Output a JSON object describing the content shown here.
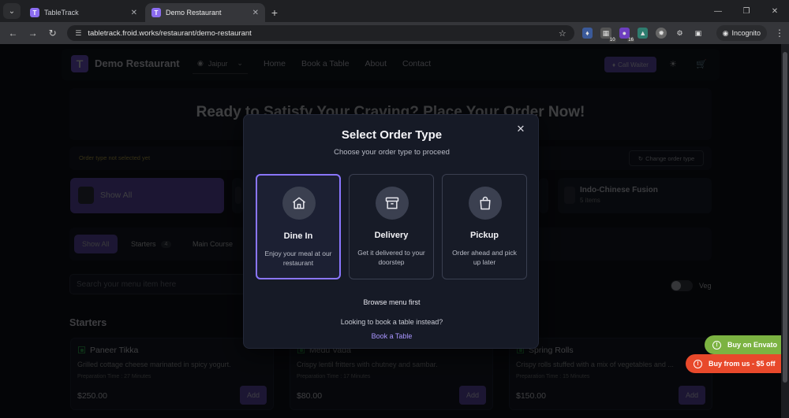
{
  "browser": {
    "tabs": [
      {
        "title": "TableTrack",
        "favicon": "T"
      },
      {
        "title": "Demo Restaurant",
        "favicon": "T"
      }
    ],
    "url": "tabletrack.froid.works/restaurant/demo-restaurant",
    "extensions": [
      {
        "icon": "shield-ext-icon",
        "badge": ""
      },
      {
        "icon": "grid-ext-icon",
        "badge": "10"
      },
      {
        "icon": "purple-ext-icon",
        "badge": "16"
      },
      {
        "icon": "color-ext-icon",
        "badge": ""
      },
      {
        "icon": "wheel-ext-icon",
        "badge": ""
      }
    ],
    "incognito_label": "Incognito"
  },
  "header": {
    "logo_letter": "T",
    "brand": "Demo Restaurant",
    "location": "Jaipur",
    "nav": [
      "Home",
      "Book a Table",
      "About",
      "Contact"
    ],
    "call_waiter": "Call Waiter"
  },
  "hero": {
    "title": "Ready to Satisfy Your Craving? Place Your Order Now!"
  },
  "order_bar": {
    "status": "Order type not selected yet",
    "change_label": "Change order type"
  },
  "categories": [
    {
      "label": "Show All"
    },
    {
      "label": "Indo-Chinese Fusion",
      "sub": "5 items"
    }
  ],
  "filters": [
    {
      "label": "Show All",
      "count": ""
    },
    {
      "label": "Starters",
      "count": "4"
    },
    {
      "label": "Main Course",
      "count": ""
    }
  ],
  "search": {
    "placeholder": "Search your menu item here"
  },
  "veg_label": "Veg",
  "section_title": "Starters",
  "menu_items": [
    {
      "name": "Paneer Tikka",
      "desc": "Grilled cottage cheese marinated in spicy yogurt.",
      "prep": "Preparation Time : 27 Minutes",
      "price": "$250.00",
      "add": "Add"
    },
    {
      "name": "Medu Vada",
      "desc": "Crispy lentil fritters with chutney and sambar.",
      "prep": "Preparation Time : 17 Minutes",
      "price": "$80.00",
      "add": "Add"
    },
    {
      "name": "Spring Rolls",
      "desc": "Crispy rolls stuffed with a mix of vegetables and ...",
      "prep": "Preparation Time : 15 Minutes",
      "price": "$150.00",
      "add": "Add"
    }
  ],
  "modal": {
    "title": "Select Order Type",
    "subtitle": "Choose your order type to proceed",
    "options": [
      {
        "label": "Dine In",
        "desc": "Enjoy your meal at our restaurant",
        "icon": "home-icon"
      },
      {
        "label": "Delivery",
        "desc": "Get it delivered to your doorstep",
        "icon": "archive-box-icon"
      },
      {
        "label": "Pickup",
        "desc": "Order ahead and pick up later",
        "icon": "shopping-bag-icon"
      }
    ],
    "browse": "Browse menu first",
    "question": "Looking to book a table instead?",
    "book_link": "Book a Table"
  },
  "promo": {
    "envato": "Buy on Envato",
    "buy_us": "Buy from us - $5 off"
  },
  "colors": {
    "accent": "#6a4fc0",
    "envato": "#7cb342",
    "buy_us": "#e8492b",
    "selected_border": "#8a76ff"
  }
}
